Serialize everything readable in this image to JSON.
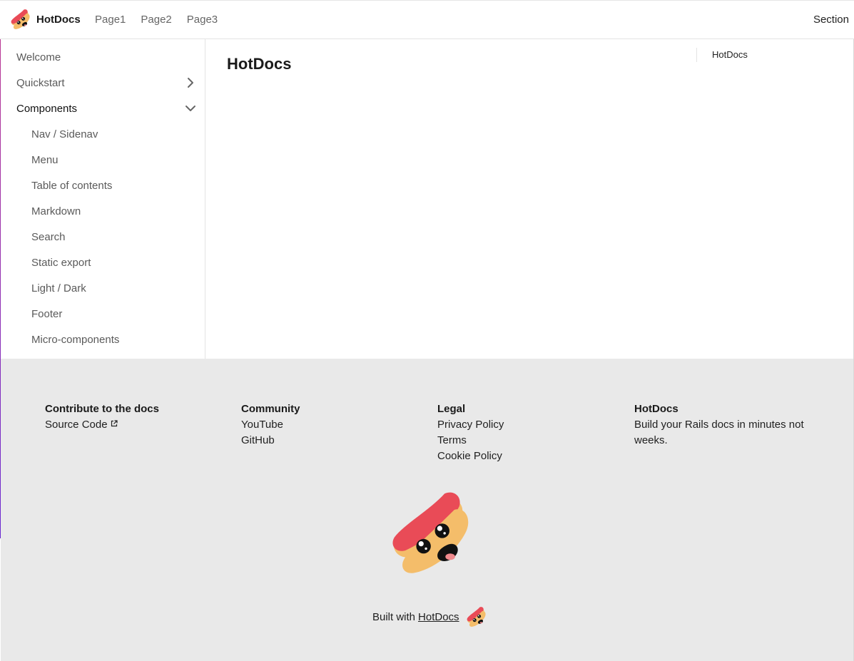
{
  "header": {
    "brand": "HotDocs",
    "nav": [
      "Page1",
      "Page2",
      "Page3"
    ],
    "section_link": "Section"
  },
  "sidebar": {
    "items": [
      {
        "label": "Welcome"
      },
      {
        "label": "Quickstart",
        "chevron": "chevron-right-icon"
      },
      {
        "label": "Components",
        "chevron": "chevron-down-icon",
        "expanded": true
      }
    ],
    "sub_items": [
      "Nav / Sidenav",
      "Menu",
      "Table of contents",
      "Markdown",
      "Search",
      "Static export",
      "Light / Dark",
      "Footer",
      "Micro-components"
    ]
  },
  "main": {
    "title": "HotDocs"
  },
  "toc": {
    "items": [
      "HotDocs"
    ]
  },
  "footer": {
    "columns": [
      {
        "heading": "Contribute to the docs",
        "links": [
          "Source Code"
        ]
      },
      {
        "heading": "Community",
        "links": [
          "YouTube",
          "GitHub"
        ]
      },
      {
        "heading": "Legal",
        "links": [
          "Privacy Policy",
          "Terms",
          "Cookie Policy"
        ]
      },
      {
        "heading": "HotDocs",
        "text": "Build your Rails docs in minutes not weeks."
      }
    ],
    "built_with_prefix": "Built with",
    "built_with_link": "HotDocs"
  },
  "colors": {
    "bun": "#f4bd6a",
    "sausage": "#e94b57",
    "footer_bg": "#e9e9e9"
  }
}
